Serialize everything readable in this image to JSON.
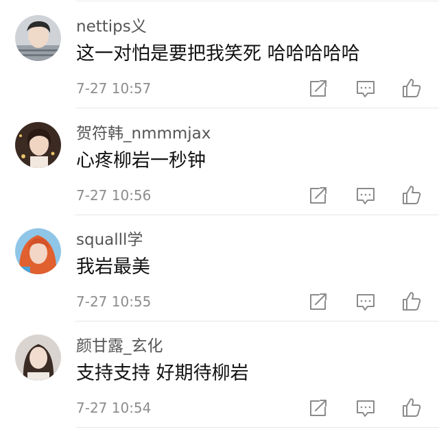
{
  "colors": {
    "username": "#555555",
    "content": "#111111",
    "time": "#8c8c8c",
    "icon": "#8a8a8a",
    "divider": "#e6e6e6"
  },
  "action_icons": [
    "share-icon",
    "reply-icon",
    "like-icon"
  ],
  "comments": [
    {
      "username": "nettips义",
      "text": "这一对怕是要把我笑死  哈哈哈哈哈",
      "time": "7-27 10:57"
    },
    {
      "username": "贺符韩_nmmmjax",
      "text": "心疼柳岩一秒钟",
      "time": "7-27 10:56"
    },
    {
      "username": "squalll学",
      "text": "我岩最美",
      "time": "7-27 10:55"
    },
    {
      "username": "颜甘露_玄化",
      "text": "支持支持 好期待柳岩",
      "time": "7-27 10:54"
    }
  ]
}
